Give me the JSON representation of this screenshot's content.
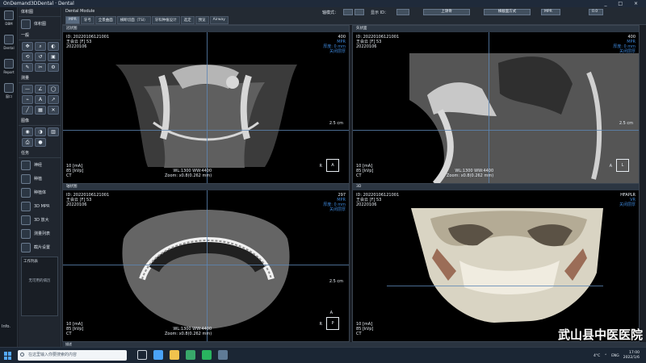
{
  "app": {
    "title": "OnDemand3DDental · Dental"
  },
  "left_nav": [
    "DBM",
    "Dental",
    "Report",
    "窗口"
  ],
  "bottom_left": "Info.",
  "tools": {
    "section1": "体积图",
    "section1_item": "体积图",
    "section2": "一般",
    "section3": "测量",
    "section4": "图像",
    "section5": "任务",
    "tasks": [
      "神经",
      "种植",
      "种植体",
      "3D MPR",
      "3D 放大",
      "测量列表",
      "截片设置"
    ],
    "worklist_title": "工作列表",
    "worklist_empty": "无可用的病历"
  },
  "topbar": {
    "module": "Dental Module",
    "tabs": [
      "MPR",
      "牙弓",
      "全景曲面",
      "横断切面（TSI）",
      "牙科种植设计",
      "选定",
      "预览",
      "Airway"
    ],
    "label_axis": "轴模式：",
    "label_ui": "显示 ID：",
    "btn_upper": "上颌骨",
    "btn_lower": "横截面方式",
    "mode": "MPR",
    "value": "0.0"
  },
  "views": [
    {
      "title": "冠状图",
      "id": "ID: 20220106121001",
      "name": "王会云 [F] 53",
      "date": "20220106",
      "num": "400",
      "type": "MPR",
      "thick": "厚度: 0 mm",
      "switch": "关闭层厚",
      "ma": "10 [mA]",
      "kvp": "85 [kVp]",
      "mod": "CT",
      "wl": "WL:1300 WW:4400",
      "zoom": "Zoom: x0.8(0.262 mm)",
      "scale": "2.5 cm",
      "left": "R",
      "cube": "A"
    },
    {
      "title": "矢状面",
      "id": "ID: 20220106121001",
      "name": "王会云 [F] 53",
      "date": "20220106",
      "num": "400",
      "type": "MPR",
      "thick": "厚度: 0 mm",
      "switch": "关闭层厚",
      "ma": "10 [mA]",
      "kvp": "85 [kVp]",
      "mod": "CT",
      "wl": "WL:1300 WW:4400",
      "zoom": "Zoom: x0.8(0.262 mm)",
      "scale": "2.5 cm",
      "left": "A",
      "cube": "L"
    },
    {
      "title": "轴状图",
      "id": "ID: 20220106121001",
      "name": "王会云 [F] 53",
      "date": "20220106",
      "num": "297",
      "type": "MPR",
      "thick": "厚度: 0 mm",
      "switch": "关闭层厚",
      "ma": "10 [mA]",
      "kvp": "85 [kVp]",
      "mod": "CT",
      "wl": "WL:1300 WW:4400",
      "zoom": "Zoom: x0.8(0.262 mm)",
      "scale": "2.5 cm",
      "left": "R",
      "cube": "A",
      "cube_bottom": "P"
    },
    {
      "title": "3D",
      "id": "ID: 20220106121001",
      "name": "王会云 [F] 53",
      "date": "20220106",
      "num": "HFAPLR",
      "type": "VR",
      "thick": "关闭层厚",
      "switch": "",
      "ma": "10 [mA]",
      "kvp": "85 [kVp]",
      "mod": "CT",
      "wl": "",
      "zoom": "",
      "scale": "",
      "left": "",
      "cube": ""
    }
  ],
  "bottom_strip": "描述",
  "taskbar": {
    "search": "在这里输入你要搜索的内容",
    "weather": "4°C",
    "lang": "ENG",
    "time": "17:00",
    "date": "2022/1/6"
  },
  "watermark": "武山县中医医院"
}
